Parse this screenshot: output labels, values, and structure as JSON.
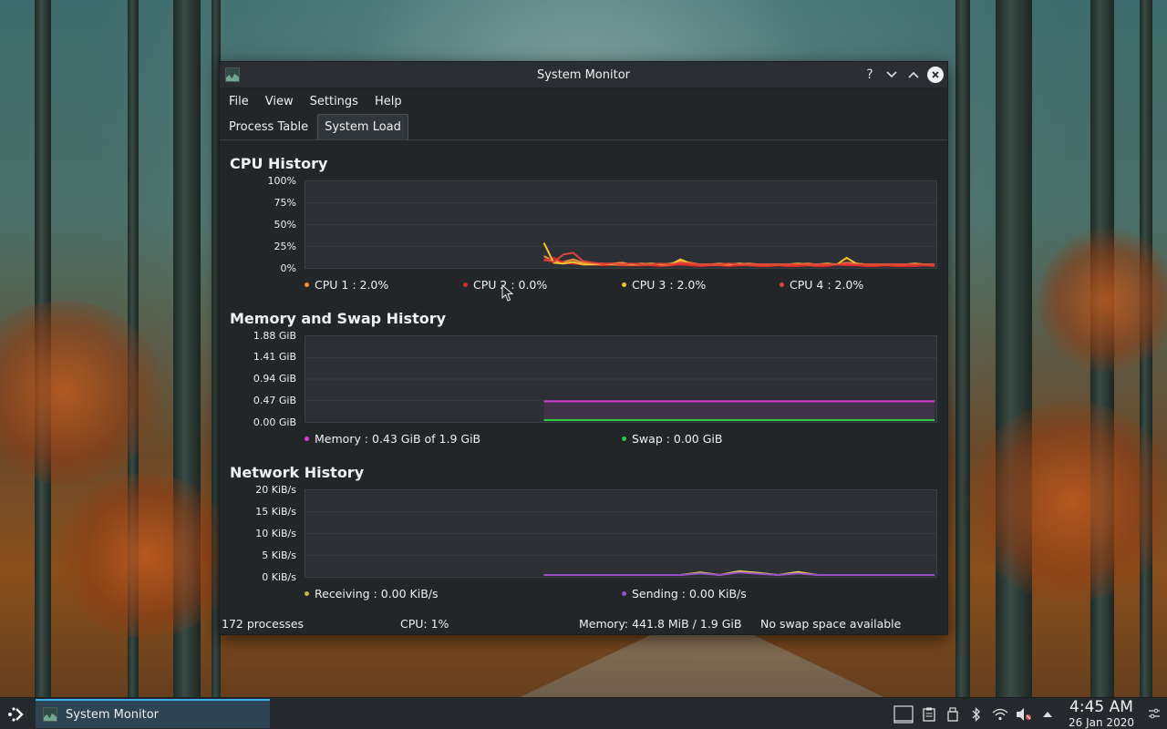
{
  "window": {
    "title": "System Monitor",
    "help_button": "?",
    "minimize_symbol": "⌄",
    "maximize_symbol": "⌃",
    "close_symbol": "✕"
  },
  "menu": {
    "items": [
      "File",
      "View",
      "Settings",
      "Help"
    ]
  },
  "tabs": [
    {
      "label": "Process Table",
      "active": false
    },
    {
      "label": "System Load",
      "active": true
    }
  ],
  "cpu": {
    "title": "CPU History",
    "ticks": [
      "100%",
      "75%",
      "50%",
      "25%",
      "0%"
    ],
    "legend": [
      {
        "label": "CPU 1 : 2.0%",
        "color": "#f0913a"
      },
      {
        "label": "CPU 2 : 0.0%",
        "color": "#e02a2a"
      },
      {
        "label": "CPU 3 : 2.0%",
        "color": "#f4c430"
      },
      {
        "label": "CPU 4 : 2.0%",
        "color": "#e0413a"
      }
    ]
  },
  "memory": {
    "title": "Memory and Swap History",
    "ticks": [
      "1.88 GiB",
      "1.41 GiB",
      "0.94 GiB",
      "0.47 GiB",
      "0.00 GiB"
    ],
    "legend": [
      {
        "label": "Memory : 0.43 GiB of 1.9 GiB",
        "color": "#d63fd6"
      },
      {
        "label": "Swap : 0.00 GiB",
        "color": "#2ecc40"
      }
    ]
  },
  "network": {
    "title": "Network History",
    "ticks": [
      "20 KiB/s",
      "15 KiB/s",
      "10 KiB/s",
      "5 KiB/s",
      "0 KiB/s"
    ],
    "legend": [
      {
        "label": "Receiving : 0.00 KiB/s",
        "color": "#c6b84a"
      },
      {
        "label": "Sending : 0.00 KiB/s",
        "color": "#9a4fc8"
      }
    ]
  },
  "chart_data": [
    {
      "type": "line",
      "title": "CPU History",
      "ylim": [
        0,
        100
      ],
      "x": [
        0,
        1,
        2,
        3,
        4,
        5,
        6,
        7,
        8,
        9,
        10,
        11,
        12,
        13,
        14,
        15,
        16,
        17,
        18,
        19,
        20,
        21,
        22,
        23,
        24,
        25,
        26,
        27,
        28,
        29,
        30,
        31,
        32,
        33,
        34,
        35,
        36,
        37,
        38,
        39,
        40
      ],
      "series": [
        {
          "name": "CPU 1",
          "values": [
            12,
            6,
            5,
            8,
            4,
            3,
            2,
            3,
            4,
            2,
            3,
            2,
            2,
            3,
            6,
            4,
            2,
            2,
            3,
            2,
            2,
            3,
            2,
            2,
            2,
            2,
            2,
            3,
            2,
            2,
            2,
            4,
            3,
            2,
            2,
            2,
            2,
            2,
            2,
            2,
            2
          ]
        },
        {
          "name": "CPU 2",
          "values": [
            6,
            10,
            4,
            3,
            2,
            2,
            1,
            2,
            1,
            1,
            1,
            1,
            0,
            1,
            2,
            1,
            0,
            1,
            1,
            0,
            1,
            1,
            0,
            0,
            1,
            0,
            0,
            1,
            0,
            0,
            2,
            1,
            1,
            0,
            0,
            1,
            0,
            0,
            0,
            1,
            0
          ]
        },
        {
          "name": "CPU 3",
          "values": [
            28,
            4,
            3,
            5,
            2,
            2,
            3,
            2,
            2,
            2,
            2,
            3,
            2,
            2,
            8,
            3,
            2,
            2,
            2,
            2,
            3,
            2,
            2,
            2,
            2,
            2,
            3,
            2,
            2,
            3,
            2,
            10,
            3,
            2,
            2,
            2,
            2,
            2,
            3,
            2,
            2
          ]
        },
        {
          "name": "CPU 4",
          "values": [
            8,
            5,
            14,
            16,
            6,
            4,
            3,
            3,
            2,
            3,
            2,
            2,
            3,
            2,
            4,
            3,
            2,
            2,
            2,
            3,
            2,
            2,
            2,
            2,
            2,
            2,
            2,
            2,
            2,
            2,
            2,
            3,
            2,
            2,
            2,
            2,
            2,
            2,
            2,
            2,
            2
          ]
        }
      ]
    },
    {
      "type": "area",
      "title": "Memory and Swap History",
      "ylim": [
        0,
        1.88
      ],
      "series": [
        {
          "name": "Memory",
          "values": [
            0.43,
            0.43
          ]
        },
        {
          "name": "Swap",
          "values": [
            0.0,
            0.0
          ]
        }
      ]
    },
    {
      "type": "line",
      "title": "Network History",
      "ylim": [
        0,
        20
      ],
      "x": [
        0,
        1,
        2,
        3,
        4,
        5,
        6,
        7,
        8,
        9,
        10,
        11,
        12,
        13,
        14,
        15,
        16,
        17,
        18,
        19,
        20
      ],
      "series": [
        {
          "name": "Receiving",
          "values": [
            0,
            0,
            0,
            0,
            0,
            0,
            0,
            0,
            0.6,
            0,
            0.9,
            0.5,
            0,
            0.7,
            0,
            0,
            0,
            0,
            0,
            0,
            0
          ]
        },
        {
          "name": "Sending",
          "values": [
            0,
            0,
            0,
            0,
            0,
            0,
            0,
            0,
            0.4,
            0,
            0.6,
            0.3,
            0,
            0.4,
            0,
            0,
            0,
            0,
            0,
            0,
            0
          ]
        }
      ]
    }
  ],
  "status": {
    "processes": "172 processes",
    "cpu": "CPU: 1%",
    "memory": "Memory: 441.8 MiB / 1.9 GiB",
    "swap": "No swap space available"
  },
  "taskbar": {
    "launcher_icon": "application-launcher-icon",
    "task_label": "System Monitor",
    "clock_time": "4:45 AM",
    "clock_date": "26 Jan 2020",
    "tray_icons": [
      "show-desktop-icon",
      "clipboard-icon",
      "usb-drive-icon",
      "bluetooth-icon",
      "wifi-icon",
      "volume-muted-icon",
      "tray-expand-icon"
    ]
  }
}
